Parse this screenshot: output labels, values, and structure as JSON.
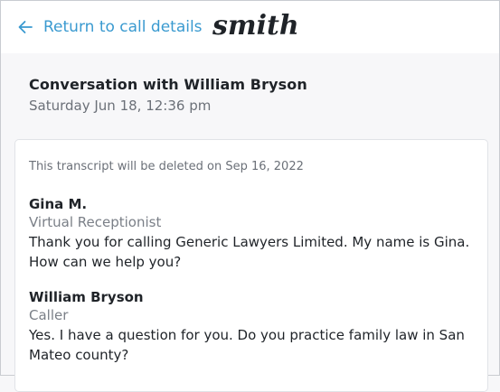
{
  "nav": {
    "back_label": "Return to call details"
  },
  "brand": {
    "logo_text": "smith"
  },
  "conversation": {
    "title": "Conversation with William Bryson",
    "date": "Saturday Jun 18, 12:36 pm"
  },
  "transcript": {
    "notice": "This transcript will be deleted on Sep 16, 2022",
    "messages": [
      {
        "speaker": "Gina M.",
        "role": "Virtual Receptionist",
        "text": "Thank you for calling Generic Lawyers Limited. My name is Gina. How can we help you?"
      },
      {
        "speaker": "William Bryson",
        "role": "Caller",
        "text": "Yes. I have a question for you. Do you practice family law in San Mateo county?"
      }
    ]
  },
  "colors": {
    "accent": "#3a9ad0",
    "muted_text": "#6b7078",
    "page_background": "#f7f7f9"
  },
  "icons": {
    "back": "arrow-left-icon"
  }
}
